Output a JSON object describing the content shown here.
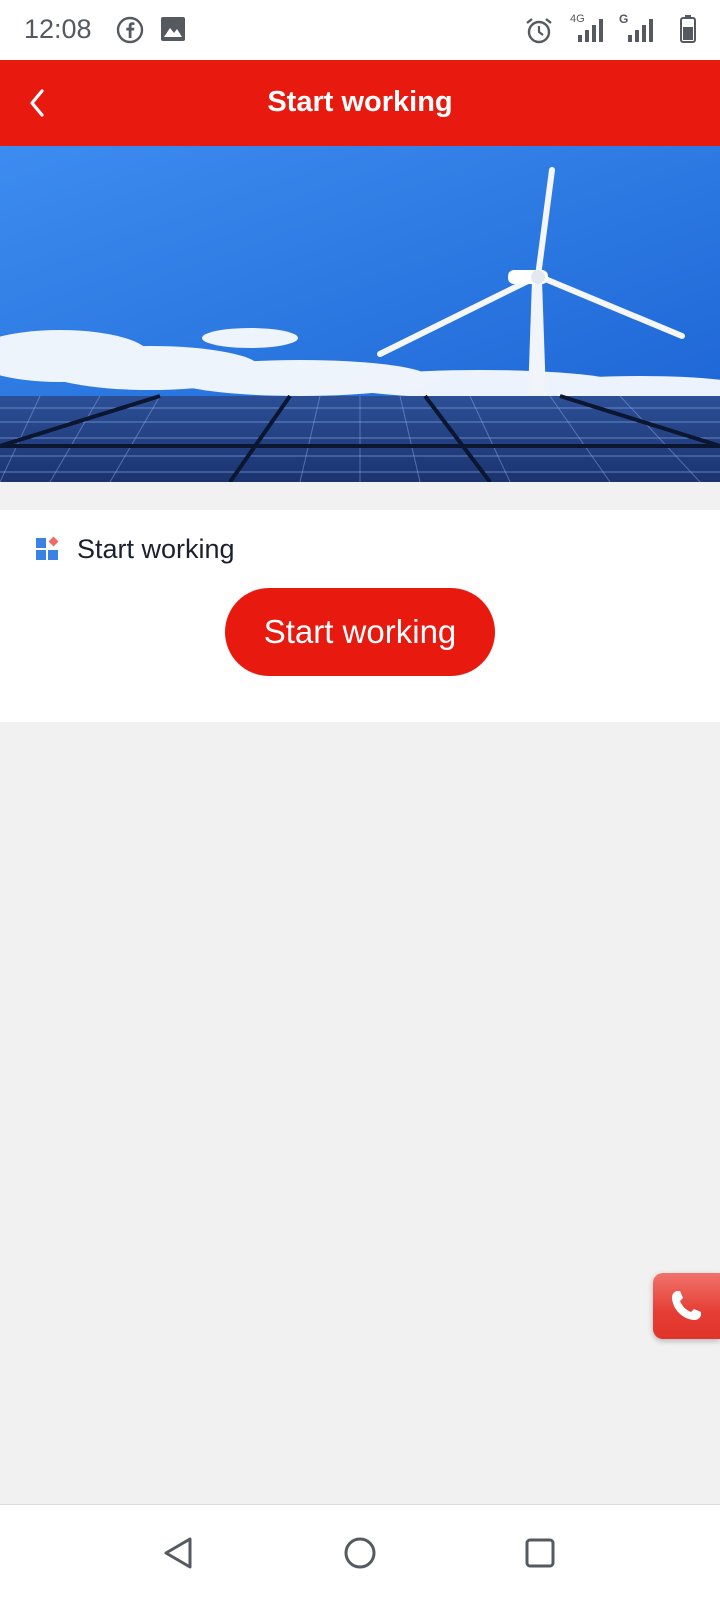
{
  "status_bar": {
    "time": "12:08",
    "network_primary": "4G",
    "network_secondary": "G",
    "icons": [
      "facebook-icon",
      "gallery-icon",
      "alarm-icon",
      "signal-icon",
      "battery-icon"
    ]
  },
  "header": {
    "title": "Start working",
    "back_icon": "chevron-left-icon"
  },
  "banner": {
    "description_icon": "wind-turbine-solar-panels-image"
  },
  "section": {
    "label": "Start working",
    "icon": "grid-app-icon",
    "button_label": "Start working"
  },
  "floating": {
    "icon": "phone-icon"
  },
  "nav_bar": {
    "icons": [
      "back-triangle-icon",
      "home-circle-icon",
      "recents-square-icon"
    ]
  },
  "colors": {
    "brand_red": "#e8190e",
    "page_background": "#f1f1f1",
    "text_dark": "#1c1f2e",
    "icon_blue": "#3b82e6"
  }
}
